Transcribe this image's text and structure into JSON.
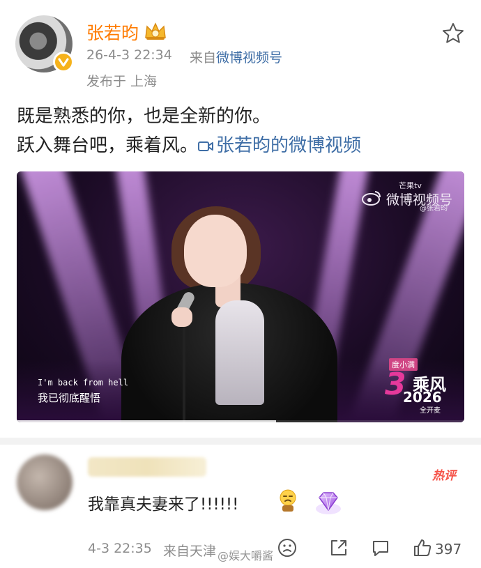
{
  "post": {
    "author": "张若昀",
    "time": "26-4-3 22:34",
    "from_prefix": "来自",
    "source": "微博视频号",
    "location": "发布于 上海",
    "line1": "既是熟悉的你，也是全新的你。",
    "line2": "跃入舞台吧，乘着风。",
    "video_link": "张若昀的微博视频"
  },
  "video": {
    "watermark_top": "芒果tv",
    "watermark_main": "微博视频号",
    "watermark_user": "@张若昀",
    "subtitle_en": "I'm back from hell",
    "subtitle_zh": "我已彻底醒悟",
    "sponsor": "度小满",
    "show_num": "3",
    "show_name": "乘风",
    "show_year": "2026",
    "show_sub": "全开麦",
    "progress": 0.58
  },
  "comment": {
    "hot_label": "热评",
    "text": "我靠真夫妻来了!!!!!!",
    "time": "4-3 22:35",
    "from": "来自天津",
    "like_count": "397"
  },
  "watermark": "@娱大嚼酱",
  "colors": {
    "username": "#ff7b00",
    "link": "#3f6ea6",
    "meta": "#8c8c8c",
    "hot": "#f55248"
  }
}
